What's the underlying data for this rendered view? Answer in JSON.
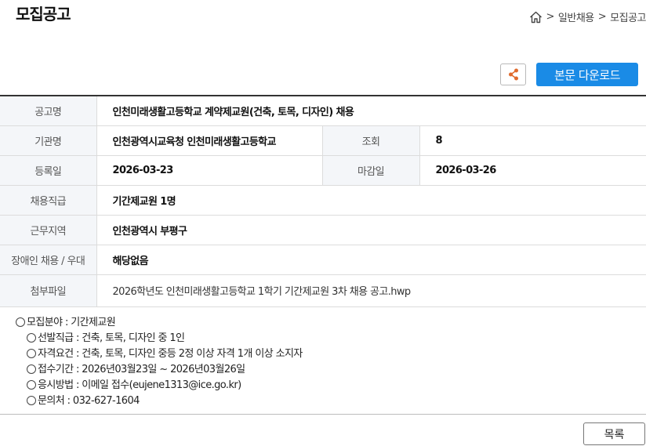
{
  "page": {
    "title": "모집공고"
  },
  "breadcrumb": {
    "sep1": ">",
    "item1": "일반채용",
    "sep2": ">",
    "item2": "모집공고"
  },
  "toolbar": {
    "share_icon": "share-icon",
    "download_label": "본문 다운로드"
  },
  "info": {
    "title": {
      "label": "공고명",
      "value": "인천미래생활고등학교 계약제교원(건축, 토목, 디자인) 채용"
    },
    "org": {
      "label": "기관명",
      "value": "인천광역시교육청 인천미래생활고등학교"
    },
    "views": {
      "label": "조회",
      "value": "8"
    },
    "reg_date": {
      "label": "등록일",
      "value": "2026-03-23"
    },
    "deadline": {
      "label": "마감일",
      "value": "2026-03-26"
    },
    "position": {
      "label": "채용직급",
      "value": "기간제교원 1명"
    },
    "location": {
      "label": "근무지역",
      "value": "인천광역시 부평구"
    },
    "disability": {
      "label": "장애인 채용 / 우대",
      "value": "해당없음"
    },
    "attachment": {
      "label": "첨부파일",
      "value": "2026학년도 인천미래생활고등학교 1학기 기간제교원 3차 채용 공고.hwp"
    }
  },
  "content": {
    "field": "모집분야 : 기간제교원",
    "items": [
      "선발직급 : 건축, 토목, 디자인 중 1인",
      "자격요건 : 건축, 토목, 디자인 중등 2정 이상 자격 1개 이상 소지자",
      "접수기간 : 2026년03월23일 ~ 2026년03월26일",
      "응시방법 : 이메일 접수(eujene1313@ice.go.kr)",
      "문의처 : 032-627-1604"
    ]
  },
  "footer": {
    "list_label": "목록"
  }
}
